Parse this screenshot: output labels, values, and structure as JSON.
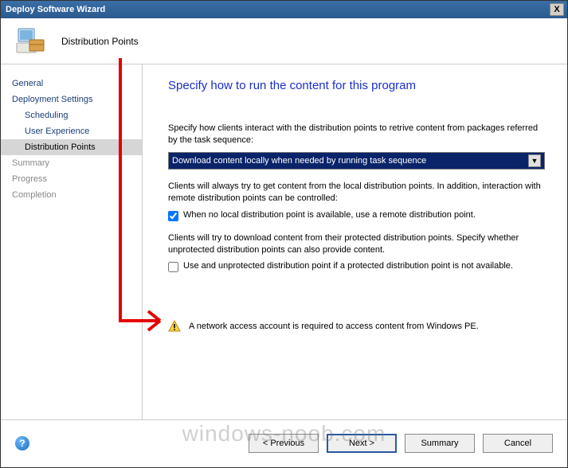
{
  "window": {
    "title": "Deploy Software Wizard",
    "close_label": "X"
  },
  "header": {
    "step_label": "Distribution Points"
  },
  "sidebar": {
    "items": [
      {
        "label": "General"
      },
      {
        "label": "Deployment Settings"
      },
      {
        "label": "Scheduling"
      },
      {
        "label": "User Experience"
      },
      {
        "label": "Distribution Points"
      },
      {
        "label": "Summary"
      },
      {
        "label": "Progress"
      },
      {
        "label": "Completion"
      }
    ]
  },
  "content": {
    "heading": "Specify how to run the content for this program",
    "intro": "Specify how clients interact with the distribution points to retrive content from packages referred by the task sequence:",
    "dropdown_value": "Download content locally when needed by running task sequence",
    "remote_para": "Clients will always try to get content from the local distribution points. In addition, interaction with remote distribution points can be controlled:",
    "remote_check_label": "When no local distribution point is available, use a remote distribution point.",
    "remote_checked": true,
    "unprot_para": "Clients will try to download content from their protected distribution points. Specify whether unprotected distribution points can also provide content.",
    "unprot_check_label": "Use and unprotected distribution point if a protected distribution point is not available.",
    "unprot_checked": false,
    "warning_text": "A network access account is required to access content from Windows PE."
  },
  "footer": {
    "help_label": "?",
    "previous": "< Previous",
    "next": "Next >",
    "summary": "Summary",
    "cancel": "Cancel"
  },
  "watermark": "windows-noob.com"
}
